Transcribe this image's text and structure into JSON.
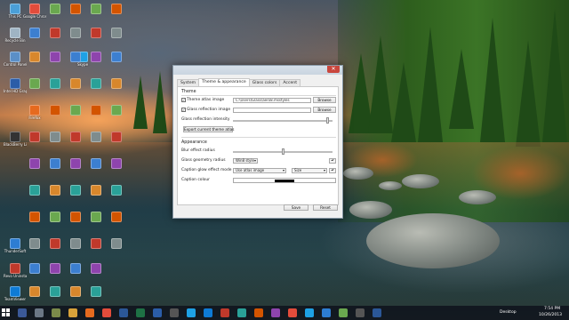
{
  "desktop": {
    "icons": [
      {
        "label": "This PC",
        "color": "#4a9fd8"
      },
      {
        "label": "Recycle Bin",
        "color": "#9fb4c4"
      },
      {
        "label": "Control Panel",
        "color": "#5b8fc7"
      },
      {
        "label": "Intel HD Graphics",
        "color": "#2b5da8"
      },
      {
        "label": "BlackBerry Link",
        "color": "#333333"
      },
      {
        "label": "Google Chrome",
        "color": "#e34c3b"
      },
      {
        "label": "Skype",
        "color": "#1ea1e5"
      },
      {
        "label": "Firefox",
        "color": "#e66a1f"
      },
      {
        "label": "ThunderSoft",
        "color": "#2d7dd2"
      },
      {
        "label": "Revo Uninstaller",
        "color": "#c0392b"
      },
      {
        "label": "TeamViewer",
        "color": "#0e7bd6"
      }
    ]
  },
  "dialog": {
    "tabs": [
      "System",
      "Theme & appearance",
      "Glass colors",
      "Accent"
    ],
    "theme_section": "Theme",
    "theme_atlas_label": "Theme atlas image",
    "theme_atlas_value": "C:\\Users\\Glass\\aero8.msstyles",
    "glass_reflection_label": "Glass reflection image",
    "glass_reflection_value": "",
    "browse_label": "Browse",
    "reflection_intensity_label": "Glass reflection intensity",
    "export_label": "Export current theme atlas",
    "appearance_section": "Appearance",
    "blur_radius_label": "Blur effect radius",
    "geometry_radius_label": "Glass geometry radius",
    "geometry_radius_value": "Win8 style",
    "caption_glow_label": "Caption glow effect mode",
    "caption_glow_value": "Use atlas image",
    "caption_glow_size": "Size",
    "caption_colour_label": "Caption colour",
    "caption_colour": "#000000",
    "save_label": "Save",
    "reset_label": "Reset",
    "reflection_intensity": 0.95,
    "blur_radius": 0.5
  },
  "taskbar": {
    "tray_label": "Desktop",
    "time": "7:54 PM",
    "date": "10/26/2013"
  }
}
